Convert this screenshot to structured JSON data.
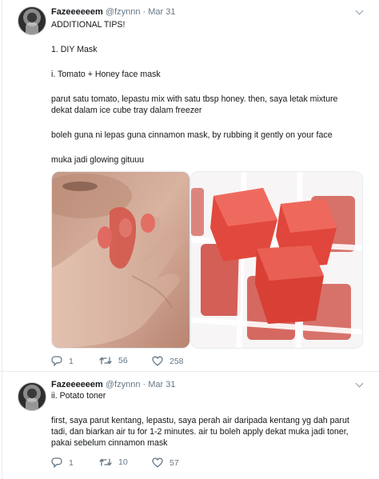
{
  "colors": {
    "accent": "#1da1f2",
    "muted": "#657786",
    "text": "#14171a"
  },
  "tweets": [
    {
      "display_name": "Fazeeeeeem",
      "handle": "@fzynnn",
      "separator": "·",
      "date": "Mar 31",
      "lines": [
        "ADDITIONAL TIPS!",
        "1. DIY Mask",
        "i. Tomato + Honey face mask",
        "parut satu tomato, lepastu mix with satu tbsp honey. then, saya letak mixture",
        "dekat dalam ice cube tray dalam freezer",
        "boleh guna ni lepas guna cinnamon mask, by rubbing it gently on your face",
        "muka jadi glowing gituuu"
      ],
      "media": [
        {
          "name": "face-photo",
          "icon": "photo"
        },
        {
          "name": "ice-cube-tray-photo",
          "icon": "photo"
        }
      ],
      "counts": {
        "reply": "1",
        "retweet": "56",
        "like": "258"
      }
    },
    {
      "display_name": "Fazeeeeeem",
      "handle": "@fzynnn",
      "separator": "·",
      "date": "Mar 31",
      "lines": [
        "ii. Potato toner",
        "first, saya parut kentang, lepastu, saya perah air daripada kentang yg dah parut",
        "tadi, dan biarkan air tu for 1-2 minutes. air tu boleh apply dekat muka jadi toner,",
        "pakai sebelum cinnamon mask"
      ],
      "counts": {
        "reply": "1",
        "retweet": "10",
        "like": "57"
      }
    }
  ]
}
